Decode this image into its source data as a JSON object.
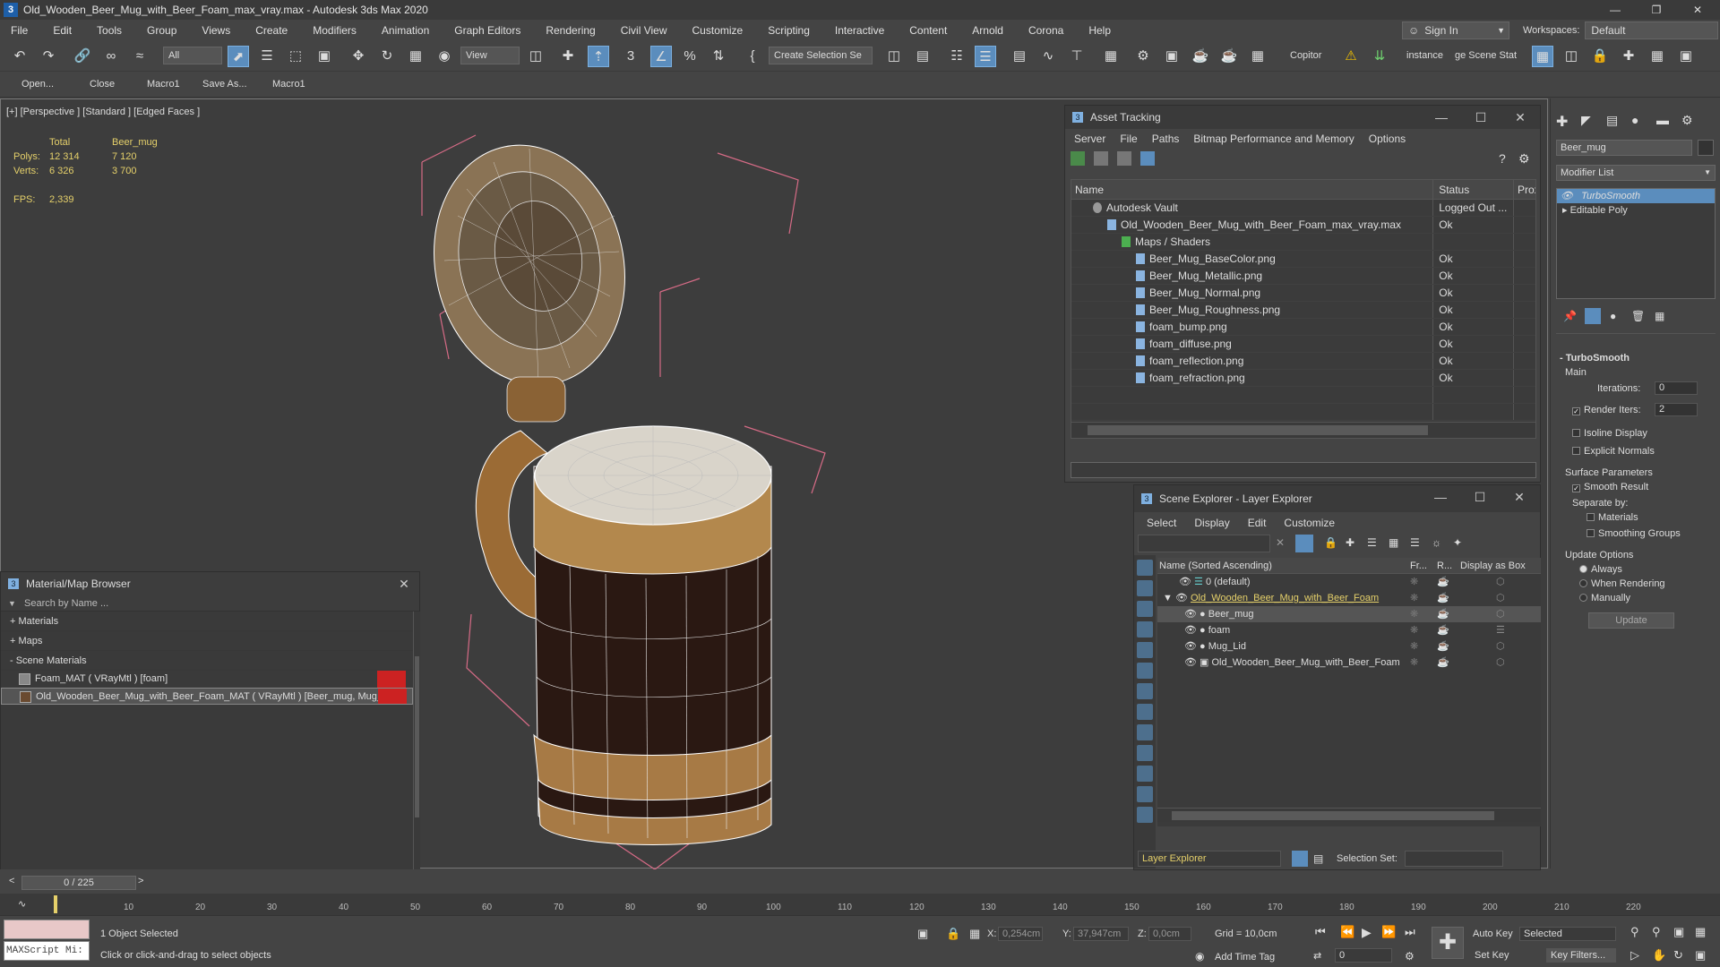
{
  "window": {
    "title": "Old_Wooden_Beer_Mug_with_Beer_Foam_max_vray.max - Autodesk 3ds Max 2020",
    "app_icon": "3"
  },
  "menu": [
    "File",
    "Edit",
    "Tools",
    "Group",
    "Views",
    "Create",
    "Modifiers",
    "Animation",
    "Graph Editors",
    "Rendering",
    "Civil View",
    "Customize",
    "Scripting",
    "Interactive",
    "Content",
    "Arnold",
    "Corona",
    "Help"
  ],
  "account": {
    "sign_in": "Sign In",
    "workspaces_label": "Workspaces:",
    "workspace_value": "Default"
  },
  "toolbar": {
    "filter_dropdown": "All",
    "coord_dropdown": "View",
    "selection_set": "Create Selection Se",
    "copitor": "Copitor",
    "instance": "instance",
    "scene_state": "ge Scene Stat"
  },
  "macros": [
    "Open...",
    "Close",
    "Macro1",
    "Save As...",
    "Macro1"
  ],
  "viewport": {
    "label": "[+] [Perspective ] [Standard ] [Edged Faces ]",
    "stats": {
      "hdr_total": "Total",
      "hdr_obj": "Beer_mug",
      "polys_label": "Polys:",
      "polys_total": "12 314",
      "polys_obj": "7 120",
      "verts_label": "Verts:",
      "verts_total": "6 326",
      "verts_obj": "3 700",
      "fps_label": "FPS:",
      "fps": "2,339"
    }
  },
  "asset_tracking": {
    "title": "Asset Tracking",
    "menu": [
      "Server",
      "File",
      "Paths",
      "Bitmap Performance and Memory",
      "Options"
    ],
    "columns": {
      "name": "Name",
      "status": "Status",
      "proxy": "Prox"
    },
    "rows": [
      {
        "name": "Autodesk Vault",
        "status": "Logged Out ..."
      },
      {
        "name": "Old_Wooden_Beer_Mug_with_Beer_Foam_max_vray.max",
        "status": "Ok"
      },
      {
        "name": "Maps / Shaders",
        "status": ""
      },
      {
        "name": "Beer_Mug_BaseColor.png",
        "status": "Ok"
      },
      {
        "name": "Beer_Mug_Metallic.png",
        "status": "Ok"
      },
      {
        "name": "Beer_Mug_Normal.png",
        "status": "Ok"
      },
      {
        "name": "Beer_Mug_Roughness.png",
        "status": "Ok"
      },
      {
        "name": "foam_bump.png",
        "status": "Ok"
      },
      {
        "name": "foam_diffuse.png",
        "status": "Ok"
      },
      {
        "name": "foam_reflection.png",
        "status": "Ok"
      },
      {
        "name": "foam_refraction.png",
        "status": "Ok"
      }
    ]
  },
  "scene_explorer": {
    "title": "Scene Explorer - Layer Explorer",
    "menu": [
      "Select",
      "Display",
      "Edit",
      "Customize"
    ],
    "columns": {
      "name": "Name (Sorted Ascending)",
      "fr": "Fr...",
      "r": "R...",
      "box": "Display as Box"
    },
    "rows": [
      {
        "name": "0 (default)"
      },
      {
        "name": "Old_Wooden_Beer_Mug_with_Beer_Foam"
      },
      {
        "name": "Beer_mug"
      },
      {
        "name": "foam"
      },
      {
        "name": "Mug_Lid"
      },
      {
        "name": "Old_Wooden_Beer_Mug_with_Beer_Foam"
      }
    ],
    "footer_dropdown": "Layer Explorer",
    "selection_set_label": "Selection Set:"
  },
  "command_panel": {
    "object_name": "Beer_mug",
    "modifier_list": "Modifier List",
    "stack": [
      "TurboSmooth",
      "Editable Poly"
    ],
    "rollout_title": "TurboSmooth",
    "main": "Main",
    "iterations_label": "Iterations:",
    "iterations": "0",
    "render_iters_label": "Render Iters:",
    "render_iters": "2",
    "isoline": "Isoline Display",
    "explicit_normals": "Explicit Normals",
    "surface_params": "Surface Parameters",
    "smooth_result": "Smooth Result",
    "separate_by": "Separate by:",
    "materials": "Materials",
    "smoothing_groups": "Smoothing Groups",
    "update_options": "Update Options",
    "always": "Always",
    "when_rendering": "When Rendering",
    "manually": "Manually",
    "update_btn": "Update"
  },
  "material_browser": {
    "title": "Material/Map Browser",
    "search_placeholder": "Search by Name ...",
    "sections": [
      "+ Materials",
      "+ Maps",
      "- Scene Materials"
    ],
    "materials": [
      "Foam_MAT ( VRayMtl ) [foam]",
      "Old_Wooden_Beer_Mug_with_Beer_Foam_MAT ( VRayMtl ) [Beer_mug, Mug_..."
    ]
  },
  "timeline": {
    "frame": "0 / 225",
    "ticks": [
      "10",
      "20",
      "30",
      "40",
      "50",
      "60",
      "70",
      "80",
      "90",
      "100",
      "110",
      "120",
      "130",
      "140",
      "150",
      "160",
      "170",
      "180",
      "190",
      "200",
      "210",
      "220"
    ]
  },
  "status": {
    "maxscript": "MAXScript Mi:",
    "selected": "1 Object Selected",
    "hint": "Click or click-and-drag to select objects",
    "x_label": "X:",
    "x": "0,254cm",
    "y_label": "Y:",
    "y": "37,947cm",
    "z_label": "Z:",
    "z": "0,0cm",
    "grid": "Grid = 10,0cm",
    "add_time_tag": "Add Time Tag",
    "auto_key": "Auto Key",
    "set_key": "Set Key",
    "key_mode": "Selected",
    "key_filters": "Key Filters...",
    "frame_field": "0"
  },
  "colors": {
    "accent": "#5b8dbd",
    "stats": "#e5d06a",
    "bbox": "#d66b86",
    "layer_text": "#e5d06a"
  }
}
